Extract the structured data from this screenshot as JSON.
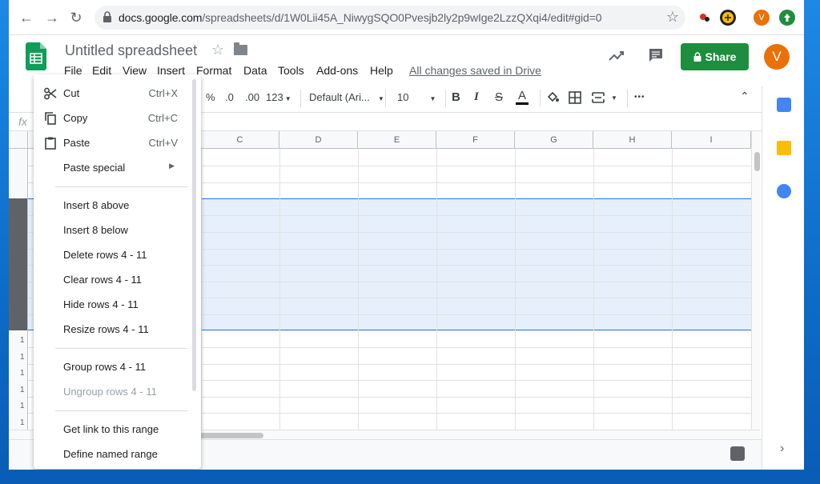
{
  "browser": {
    "url_host": "docs.google.com",
    "url_path": "/spreadsheets/d/1W0Lii45A_NiwygSQO0Pvesjb2ly2p9wIge2LzzQXqi4/edit#gid=0",
    "ext_avatar_letter": "V"
  },
  "doc": {
    "title": "Untitled spreadsheet",
    "save_status": "All changes saved in Drive",
    "share_label": "Share",
    "avatar_letter": "V"
  },
  "menubar": [
    "File",
    "Edit",
    "View",
    "Insert",
    "Format",
    "Data",
    "Tools",
    "Add-ons",
    "Help"
  ],
  "toolbar": {
    "percent": "%",
    "decimal_less": ".0",
    "decimal_more": ".00",
    "format_more": "123",
    "font": "Default (Ari...",
    "font_size": "10",
    "bold": "B",
    "italic": "I",
    "strike": "S",
    "text_color": "A",
    "more": "•••"
  },
  "formula_bar": {
    "fx": "fx"
  },
  "columns": [
    "C",
    "D",
    "E",
    "F",
    "G",
    "H",
    "I"
  ],
  "row_headers": [
    "1",
    "1",
    "1",
    "1",
    "1",
    "1"
  ],
  "context_menu": {
    "cut": {
      "label": "Cut",
      "shortcut": "Ctrl+X"
    },
    "copy": {
      "label": "Copy",
      "shortcut": "Ctrl+C"
    },
    "paste": {
      "label": "Paste",
      "shortcut": "Ctrl+V"
    },
    "paste_special": {
      "label": "Paste special"
    },
    "insert_above": {
      "label": "Insert 8 above"
    },
    "insert_below": {
      "label": "Insert 8 below"
    },
    "delete_rows": {
      "label": "Delete rows 4 - 11"
    },
    "clear_rows": {
      "label": "Clear rows 4 - 11"
    },
    "hide_rows": {
      "label": "Hide rows 4 - 11"
    },
    "resize_rows": {
      "label": "Resize rows 4 - 11"
    },
    "group_rows": {
      "label": "Group rows 4 - 11"
    },
    "ungroup_rows": {
      "label": "Ungroup rows 4 - 11"
    },
    "get_link": {
      "label": "Get link to this range"
    },
    "named_range": {
      "label": "Define named range"
    }
  },
  "colors": {
    "share_green": "#1e8e3e",
    "avatar_orange": "#e8710a",
    "selection_blue": "#1a73e8",
    "sheets_green": "#0f9d58"
  }
}
